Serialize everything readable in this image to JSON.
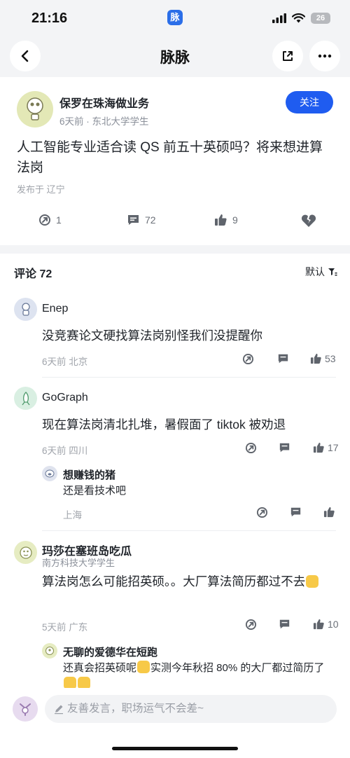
{
  "status_bar": {
    "time": "21:16",
    "app_badge": "脉",
    "battery": "26"
  },
  "nav": {
    "title": "脉脉"
  },
  "post": {
    "author": "保罗在珠海做业务",
    "meta": "6天前 · 东北大学学生",
    "follow_label": "关注",
    "text": "人工智能专业适合读 QS 前五十英硕吗？将来想进算法岗",
    "location": "发布于 辽宁",
    "actions": {
      "share_count": "1",
      "comment_count": "72",
      "like_count": "9"
    }
  },
  "comments_section": {
    "header": "评论 72",
    "sort_label": "默认",
    "comments": [
      {
        "name": "Enep",
        "text": "没竞赛论文硬找算法岗别怪我们没提醒你",
        "meta": "6天前  北京",
        "likes": "53"
      },
      {
        "name": "GoGraph",
        "text": "现在算法岗清北扎堆，暑假面了 tiktok 被劝退",
        "meta": "6天前  四川",
        "likes": "17",
        "reply": {
          "name": "想赚钱的猪",
          "text": "还是看技术吧",
          "meta": "上海"
        }
      },
      {
        "name": "玛莎在塞班岛吃瓜",
        "subtitle": "南方科技大学学生",
        "text": "算法岗怎么可能招英硕。。大厂算法简历都过不去",
        "meta": "5天前  广东",
        "likes": "10",
        "reply": {
          "name": "无聊的爱德华在短跑",
          "text": "还真会招英硕呢",
          "text2": "实测今年秋招 80% 的大厂都过简历了"
        }
      }
    ]
  },
  "bottom": {
    "input_placeholder": "友善发言，职场运气不会差~"
  },
  "colors": {
    "accent": "#1f5cf0",
    "text": "#1f2329",
    "muted": "#8a8f99"
  }
}
